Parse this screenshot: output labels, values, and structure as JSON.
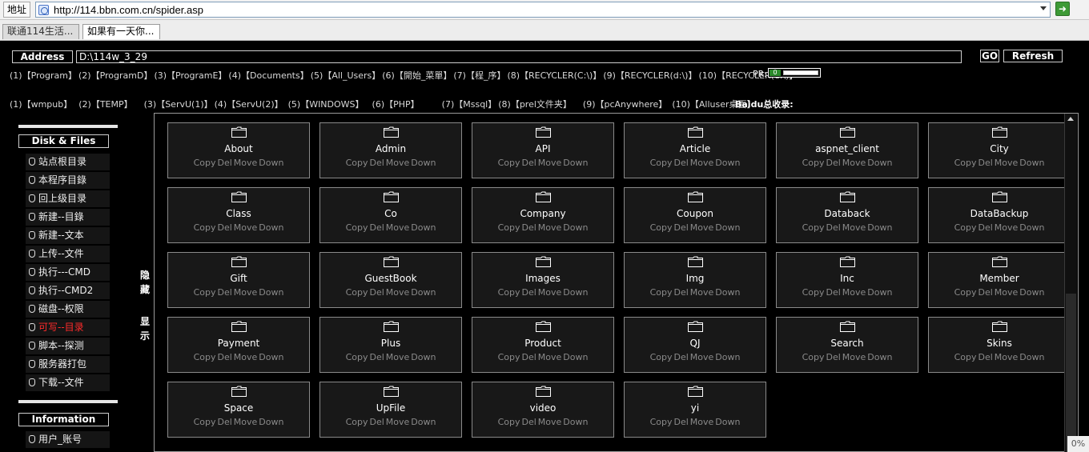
{
  "browser": {
    "address_label": "地址",
    "url": "http://114.bbn.com.cn/spider.asp",
    "tabs": [
      "联通114生活...",
      "如果有一天你..."
    ]
  },
  "toolbar": {
    "address_label": "Address",
    "path_value": "D:\\114w_3_29",
    "go_label": "GO",
    "refresh_label": "Refresh"
  },
  "quick_links_row1": [
    "(1)【Program】",
    "(2)【ProgramD】",
    "(3)【ProgramE】",
    "(4)【Documents】",
    "(5)【All_Users】",
    "(6)【開始_菜單】",
    "(7)【程_序】",
    "(8)【RECYCLER(C:\\)】",
    "(9)【RECYCLER(d:\\)】",
    "(10)【RECYCLER(e:\\)】"
  ],
  "pr": {
    "label": "PR:",
    "value": "0"
  },
  "quick_links_row2": [
    "(1)【wmpub】",
    "(2)【TEMP】",
    "(3)【ServU(1)】",
    "(4)【ServU(2)】",
    "(5)【WINDOWS】",
    "(6)【PHP】",
    "(7)【Mssql】",
    "(8)【prel文件夹】",
    "(9)【pcAnywhere】",
    "(10)【Alluser桌面】"
  ],
  "baidu_label": "Baidu总收录:",
  "sidebar": {
    "disk_header": "Disk & Files",
    "disk_items": [
      {
        "label": "站点根目录"
      },
      {
        "label": "本程序目錄"
      },
      {
        "label": "回上级目录"
      },
      {
        "label": "新建--目錄"
      },
      {
        "label": "新建--文本"
      },
      {
        "label": "上传--文件"
      },
      {
        "label": "执行---CMD"
      },
      {
        "label": "执行--CMD2"
      },
      {
        "label": "磁盘--权限"
      },
      {
        "label": "可写--目录"
      },
      {
        "label": "脚本--探测"
      },
      {
        "label": "服务器打包"
      },
      {
        "label": "下载--文件"
      }
    ],
    "info_header": "Information",
    "info_items": [
      {
        "label": "用户_账号"
      }
    ],
    "highlight_color": "#ff2b2b"
  },
  "toggle": {
    "hide": "隐藏",
    "show": "显示"
  },
  "actions": {
    "copy": "Copy",
    "del": "Del",
    "move": "Move",
    "down": "Down"
  },
  "folders": [
    {
      "name": "About"
    },
    {
      "name": "Admin"
    },
    {
      "name": "API"
    },
    {
      "name": "Article"
    },
    {
      "name": "aspnet_client"
    },
    {
      "name": "City"
    },
    {
      "name": "Class"
    },
    {
      "name": "Co"
    },
    {
      "name": "Company"
    },
    {
      "name": "Coupon"
    },
    {
      "name": "Databack"
    },
    {
      "name": "DataBackup"
    },
    {
      "name": "Gift"
    },
    {
      "name": "GuestBook"
    },
    {
      "name": "Images"
    },
    {
      "name": "Img"
    },
    {
      "name": "Inc"
    },
    {
      "name": "Member"
    },
    {
      "name": "Payment"
    },
    {
      "name": "Plus"
    },
    {
      "name": "Product"
    },
    {
      "name": "QJ"
    },
    {
      "name": "Search"
    },
    {
      "name": "Skins"
    },
    {
      "name": "Space"
    },
    {
      "name": "UpFile"
    },
    {
      "name": "video"
    },
    {
      "name": "yi"
    }
  ],
  "status_corner": "0%"
}
